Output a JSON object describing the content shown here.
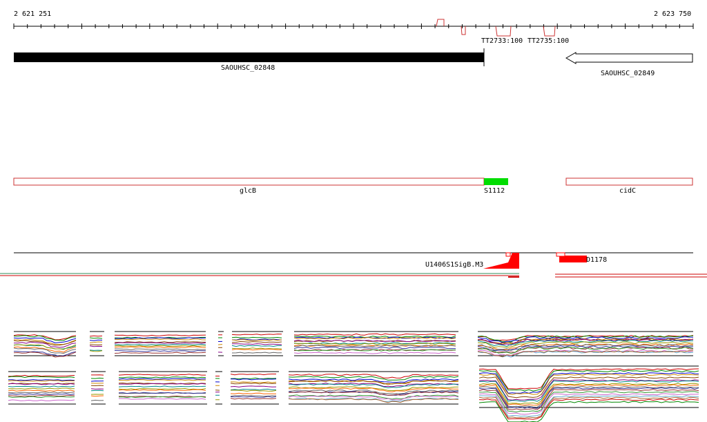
{
  "ruler": {
    "start_label": "2 621 251",
    "end_label": "2 623 750"
  },
  "terminators": [
    {
      "label": "TT2733:100",
      "color": "#cc3333"
    },
    {
      "label": "TT2735:100",
      "color": "#cc3333"
    }
  ],
  "genes": [
    {
      "label": "SAOUHSC_02848",
      "strand": "+",
      "color": "#000000"
    },
    {
      "label": "SAOUHSC_02849",
      "strand": "-",
      "color": "#ffffff"
    }
  ],
  "annotations": [
    {
      "label": "glcB",
      "color": "#cc3333"
    },
    {
      "label": "S1112",
      "color": "#00dd00"
    },
    {
      "label": "cidC",
      "color": "#cc3333"
    }
  ],
  "segments": [
    {
      "label": "U1406S1SigB.M3",
      "color": "#ff0000"
    },
    {
      "label": "D1178",
      "color": "#ff0000"
    }
  ],
  "colors": {
    "axis": "#000000",
    "annotation_outline": "#cc3333",
    "green_track": "#2e8b57",
    "red_track": "#cc0000"
  }
}
